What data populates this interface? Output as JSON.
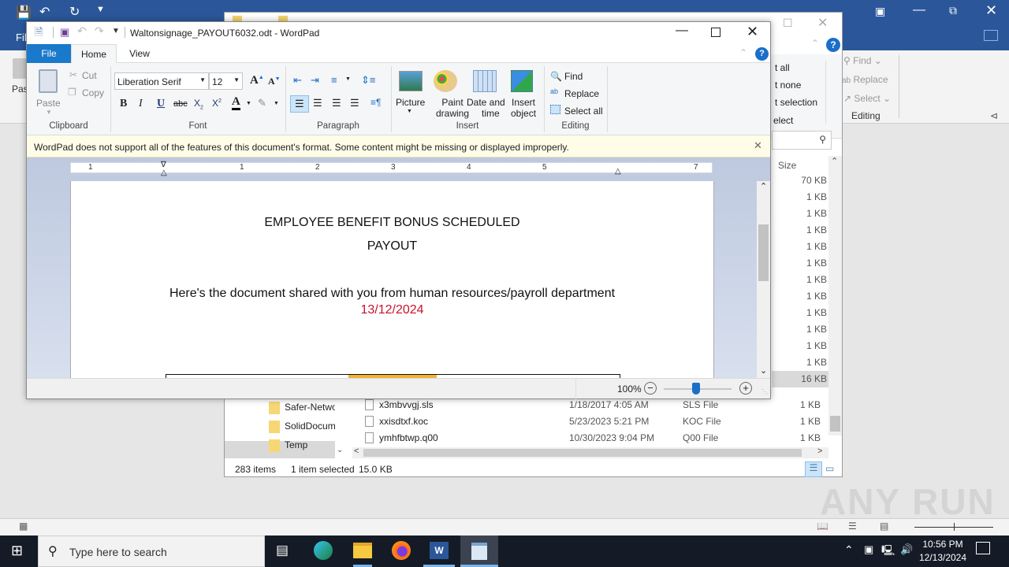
{
  "word_bg": {
    "file_tab": "Fil",
    "paste_label": "Pas",
    "editing": {
      "find": "Find",
      "replace": "Replace",
      "select": "Select",
      "group_label": "Editing"
    }
  },
  "explorer": {
    "ribbon_partial": {
      "select_all": "t all",
      "select_none": "t none",
      "invert_selection": "t selection",
      "select": "elect"
    },
    "column_size": "Size",
    "sizes": [
      "70 KB",
      "1 KB",
      "1 KB",
      "1 KB",
      "1 KB",
      "1 KB",
      "1 KB",
      "1 KB",
      "1 KB",
      "1 KB",
      "1 KB",
      "1 KB",
      "16 KB"
    ],
    "nav_folders": [
      "Safer-Netwo",
      "SolidDocum",
      "Temp"
    ],
    "files": [
      {
        "name": "x3mbvvgj.sls",
        "date": "1/18/2017 4:05 AM",
        "type": "SLS File",
        "size": "1 KB"
      },
      {
        "name": "xxisdtxf.koc",
        "date": "5/23/2023 5:21 PM",
        "type": "KOC File",
        "size": "1 KB"
      },
      {
        "name": "ymhfbtwp.q00",
        "date": "10/30/2023 9:04 PM",
        "type": "Q00 File",
        "size": "1 KB"
      }
    ],
    "status": {
      "items": "283 items",
      "selected": "1 item selected",
      "size": "15.0 KB"
    }
  },
  "wordpad": {
    "title": "Waltonsignage_PAYOUT6032.odt - WordPad",
    "tabs": {
      "file": "File",
      "home": "Home",
      "view": "View"
    },
    "clipboard": {
      "paste": "Paste",
      "cut": "Cut",
      "copy": "Copy",
      "label": "Clipboard"
    },
    "font": {
      "family": "Liberation Serif",
      "size": "12",
      "label": "Font"
    },
    "paragraph": {
      "label": "Paragraph"
    },
    "insert": {
      "picture": "Picture",
      "paint": "Paint drawing",
      "paint1": "Paint",
      "paint2": "drawing",
      "date1": "Date and",
      "date2": "time",
      "obj1": "Insert",
      "obj2": "object",
      "label": "Insert"
    },
    "editing": {
      "find": "Find",
      "replace": "Replace",
      "select_all": "Select all",
      "label": "Editing"
    },
    "warning": "WordPad does not support all of the features of this document's format. Some content might be missing or displayed improperly.",
    "ruler_numbers": [
      "1",
      "1",
      "2",
      "3",
      "4",
      "5",
      "7"
    ],
    "document": {
      "heading1": "EMPLOYEE BENEFIT BONUS SCHEDULED",
      "heading2": "PAYOUT",
      "body": "Here's the document shared with you from human resources/payroll department",
      "date": "13/12/2024"
    },
    "zoom": {
      "level": "100%",
      "value_percent": 100
    }
  },
  "taskbar": {
    "search_placeholder": "Type here to search",
    "time": "10:56 PM",
    "date": "12/13/2024"
  },
  "watermark": "ANY RUN",
  "colors": {
    "accent": "#2b579a",
    "date_red": "#c8102e",
    "file_tab": "#1979ca",
    "warning_bg": "#fffde7",
    "taskbar": "#141b26"
  }
}
